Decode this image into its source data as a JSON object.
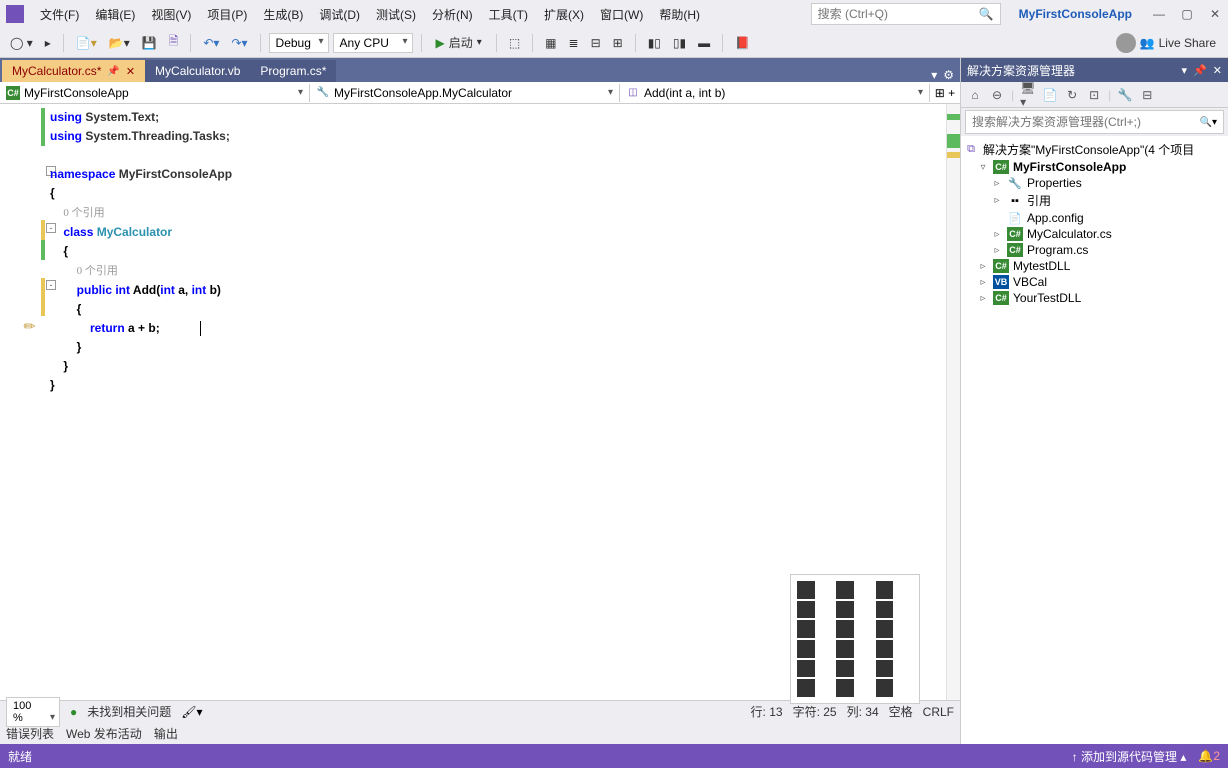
{
  "menu": {
    "items": [
      "文件(F)",
      "编辑(E)",
      "视图(V)",
      "项目(P)",
      "生成(B)",
      "调试(D)",
      "测试(S)",
      "分析(N)",
      "工具(T)",
      "扩展(X)",
      "窗口(W)",
      "帮助(H)"
    ]
  },
  "search": {
    "placeholder": "搜索 (Ctrl+Q)"
  },
  "project_name": "MyFirstConsoleApp",
  "toolbar": {
    "config": "Debug",
    "platform": "Any CPU",
    "start": "启动"
  },
  "live_share": "Live Share",
  "tabs": [
    {
      "label": "MyCalculator.cs*",
      "active": true,
      "pinned": true
    },
    {
      "label": "MyCalculator.vb",
      "active": false
    },
    {
      "label": "Program.cs*",
      "active": false
    }
  ],
  "breadcrumb": {
    "scope": "MyFirstConsoleApp",
    "class": "MyFirstConsoleApp.MyCalculator",
    "member": "Add(int a, int b)"
  },
  "code": {
    "l1a": "using",
    "l1b": " System.Text;",
    "l2a": "using",
    "l2b": " System.Threading.Tasks;",
    "l4a": "namespace",
    "l4b": " MyFirstConsoleApp",
    "l5": "{",
    "ref1": "0 个引用",
    "l6a": "class",
    "l6b": " MyCalculator",
    "l7": "{",
    "ref2": "0 个引用",
    "l8a": "public",
    "l8b": " int",
    "l8c": " Add(",
    "l8d": "int",
    "l8e": " a, ",
    "l8f": "int",
    "l8g": " b)",
    "l9": "{",
    "l10a": "return",
    "l10b": " a + b;",
    "l11": "}",
    "l12": "}",
    "l13": "}"
  },
  "zoom": {
    "level": "100 %",
    "issues": "未找到相关问题",
    "line": "行: 13",
    "char": "字符: 25",
    "col": "列: 34",
    "ins": "空格",
    "enc": "CRLF"
  },
  "output_tabs": [
    "错误列表",
    "Web 发布活动",
    "输出"
  ],
  "solution": {
    "title": "解决方案资源管理器",
    "search_placeholder": "搜索解决方案资源管理器(Ctrl+;)",
    "root": "解决方案\"MyFirstConsoleApp\"(4 个项目",
    "nodes": [
      {
        "label": "MyFirstConsoleApp",
        "icon": "cs",
        "bold": true,
        "indent": 1,
        "arrow": "▿",
        "children": [
          {
            "label": "Properties",
            "icon": "wrench",
            "indent": 2,
            "arrow": "▹"
          },
          {
            "label": "引用",
            "icon": "ref",
            "indent": 2,
            "arrow": "▹"
          },
          {
            "label": "App.config",
            "icon": "cfg",
            "indent": 2,
            "arrow": ""
          },
          {
            "label": "MyCalculator.cs",
            "icon": "cs",
            "indent": 2,
            "arrow": "▹"
          },
          {
            "label": "Program.cs",
            "icon": "cs",
            "indent": 2,
            "arrow": "▹"
          }
        ]
      },
      {
        "label": "MytestDLL",
        "icon": "cs",
        "indent": 1,
        "arrow": "▹"
      },
      {
        "label": "VBCal",
        "icon": "vb",
        "indent": 1,
        "arrow": "▹"
      },
      {
        "label": "YourTestDLL",
        "icon": "cs",
        "indent": 1,
        "arrow": "▹"
      }
    ]
  },
  "status": {
    "ready": "就绪",
    "scm": "↑ 添加到源代码管理 ▴",
    "notif": "2"
  }
}
